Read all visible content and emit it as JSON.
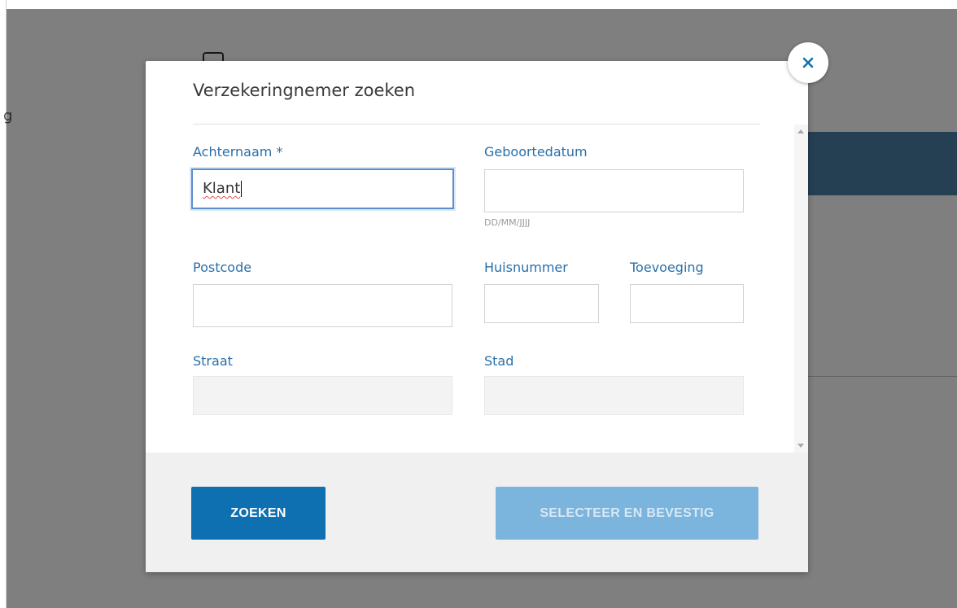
{
  "modal": {
    "title": "Verzekeringnemer zoeken",
    "fields": {
      "achternaam": {
        "label": "Achternaam *",
        "value": "Klant"
      },
      "geboortedatum": {
        "label": "Geboortedatum",
        "value": "",
        "hint": "DD/MM/JJJJ"
      },
      "postcode": {
        "label": "Postcode",
        "value": ""
      },
      "huisnummer": {
        "label": "Huisnummer",
        "value": ""
      },
      "toevoeging": {
        "label": "Toevoeging",
        "value": ""
      },
      "straat": {
        "label": "Straat",
        "value": ""
      },
      "stad": {
        "label": "Stad",
        "value": ""
      }
    },
    "buttons": {
      "search_label": "ZOEKEN",
      "confirm_label": "SELECTEER EN BEVESTIG"
    },
    "close_icon": "close-icon"
  },
  "background": {
    "edge_letter": "g"
  },
  "colors": {
    "label_blue": "#2a6fa8",
    "primary_button": "#0e70b0",
    "disabled_button": "#7bb4dc",
    "overlay": "rgba(0,0,0,0.5)"
  }
}
